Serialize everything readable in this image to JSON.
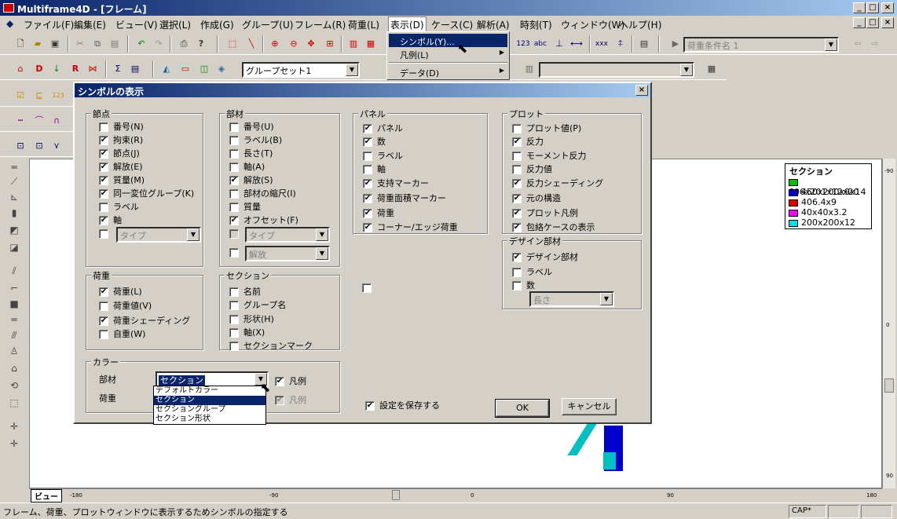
{
  "window": {
    "title": "Multiframe4D - [フレーム]"
  },
  "menubar": [
    "ファイル(F)",
    "編集(E)",
    "ビュー(V)",
    "選択(L)",
    "作成(G)",
    "グループ(U)",
    "フレーム(R)",
    "荷重(L)",
    "表示(D)",
    "ケース(C)",
    "解析(A)",
    "時刻(T)",
    "ウィンドウ(W)",
    "ヘルプ(H)"
  ],
  "toolbar": {
    "load_case_placeholder": "荷重条件名 1",
    "group_set": "グループセット1"
  },
  "display_menu": {
    "items": [
      {
        "label": "シンボル(Y)...",
        "highlighted": true
      },
      {
        "label": "凡例(L)",
        "submenu": true
      },
      {
        "label": "データ(D)",
        "submenu": true
      }
    ]
  },
  "legend": {
    "title": "セクション",
    "items": [
      {
        "label": "606x201x12x20",
        "color": "#00c000"
      },
      {
        "label": "450x200x9x14",
        "color": "#0000cc"
      },
      {
        "label": "406.4x9",
        "color": "#e00000"
      },
      {
        "label": "40x40x3.2",
        "color": "#ff00ff"
      },
      {
        "label": "200x200x12",
        "color": "#00e0e0"
      }
    ]
  },
  "ruler": {
    "ticks": [
      "-180",
      "-90",
      "0",
      "90",
      "180"
    ],
    "right_ticks": [
      "-90",
      "0",
      "90"
    ],
    "view_tab": "ビュー"
  },
  "status": {
    "text": "フレーム、荷重、プロットウィンドウに表示するためシンボルの指定する",
    "cap": "CAP*"
  },
  "dialog": {
    "title": "シンボルの表示",
    "nodes": {
      "title": "節点",
      "items": [
        {
          "label": "番号(N)",
          "checked": false
        },
        {
          "label": "拘束(R)",
          "checked": true
        },
        {
          "label": "節点(J)",
          "checked": true
        },
        {
          "label": "解放(E)",
          "checked": true
        },
        {
          "label": "質量(M)",
          "checked": true
        },
        {
          "label": "同一変位グループ(K)",
          "checked": true
        },
        {
          "label": "ラベル",
          "checked": false
        },
        {
          "label": "軸",
          "checked": true
        }
      ],
      "type_combo": "タイプ"
    },
    "members": {
      "title": "部材",
      "items": [
        {
          "label": "番号(U)",
          "checked": false
        },
        {
          "label": "ラベル(B)",
          "checked": false
        },
        {
          "label": "長さ(T)",
          "checked": false
        },
        {
          "label": "軸(A)",
          "checked": false
        },
        {
          "label": "解放(S)",
          "checked": true
        },
        {
          "label": "部材の縮尺(I)",
          "checked": false
        },
        {
          "label": "質量",
          "checked": false
        },
        {
          "label": "オフセット(F)",
          "checked": true
        }
      ],
      "type_combo": "タイプ",
      "release_combo": "解放"
    },
    "panels": {
      "title": "パネル",
      "items": [
        {
          "label": "パネル",
          "checked": true
        },
        {
          "label": "数",
          "checked": true
        },
        {
          "label": "ラベル",
          "checked": false
        },
        {
          "label": "軸",
          "checked": false
        },
        {
          "label": "支持マーカー",
          "checked": true
        },
        {
          "label": "荷重面積マーカー",
          "checked": true
        },
        {
          "label": "荷重",
          "checked": true
        },
        {
          "label": "コーナー/エッジ荷重",
          "checked": true
        }
      ]
    },
    "plot": {
      "title": "プロット",
      "items": [
        {
          "label": "プロット値(P)",
          "checked": false
        },
        {
          "label": "反力",
          "checked": true
        },
        {
          "label": "モーメント反力",
          "checked": false
        },
        {
          "label": "反力値",
          "checked": false
        },
        {
          "label": "反力シェーディング",
          "checked": true
        },
        {
          "label": "元の構造",
          "checked": true
        },
        {
          "label": "プロット凡例",
          "checked": true
        },
        {
          "label": "包絡ケースの表示",
          "checked": true
        }
      ]
    },
    "design": {
      "title": "デザイン部材",
      "items": [
        {
          "label": "デザイン部材",
          "checked": true
        },
        {
          "label": "ラベル",
          "checked": false
        },
        {
          "label": "数",
          "checked": false
        }
      ],
      "length_combo": "長さ"
    },
    "loads": {
      "title": "荷重",
      "items": [
        {
          "label": "荷重(L)",
          "checked": true
        },
        {
          "label": "荷重値(V)",
          "checked": false
        },
        {
          "label": "荷重シェーディング",
          "checked": true
        },
        {
          "label": "自重(W)",
          "checked": false
        }
      ]
    },
    "sections": {
      "title": "セクション",
      "items": [
        {
          "label": "名前",
          "checked": false
        },
        {
          "label": "グループ名",
          "checked": false
        },
        {
          "label": "形状(H)",
          "checked": false
        },
        {
          "label": "軸(X)",
          "checked": false
        },
        {
          "label": "セクションマーク",
          "checked": false
        }
      ]
    },
    "color": {
      "title": "カラー",
      "member_label": "部材",
      "load_label": "荷重",
      "member_value": "セクション",
      "legend_label": "凡例",
      "legend2_label": "凡例",
      "options": [
        "デフォルトカラー",
        "セクション",
        "セクショングループ",
        "セクション形状"
      ]
    },
    "save_settings": "設定を保存する",
    "ok": "OK",
    "cancel": "キャンセル"
  }
}
